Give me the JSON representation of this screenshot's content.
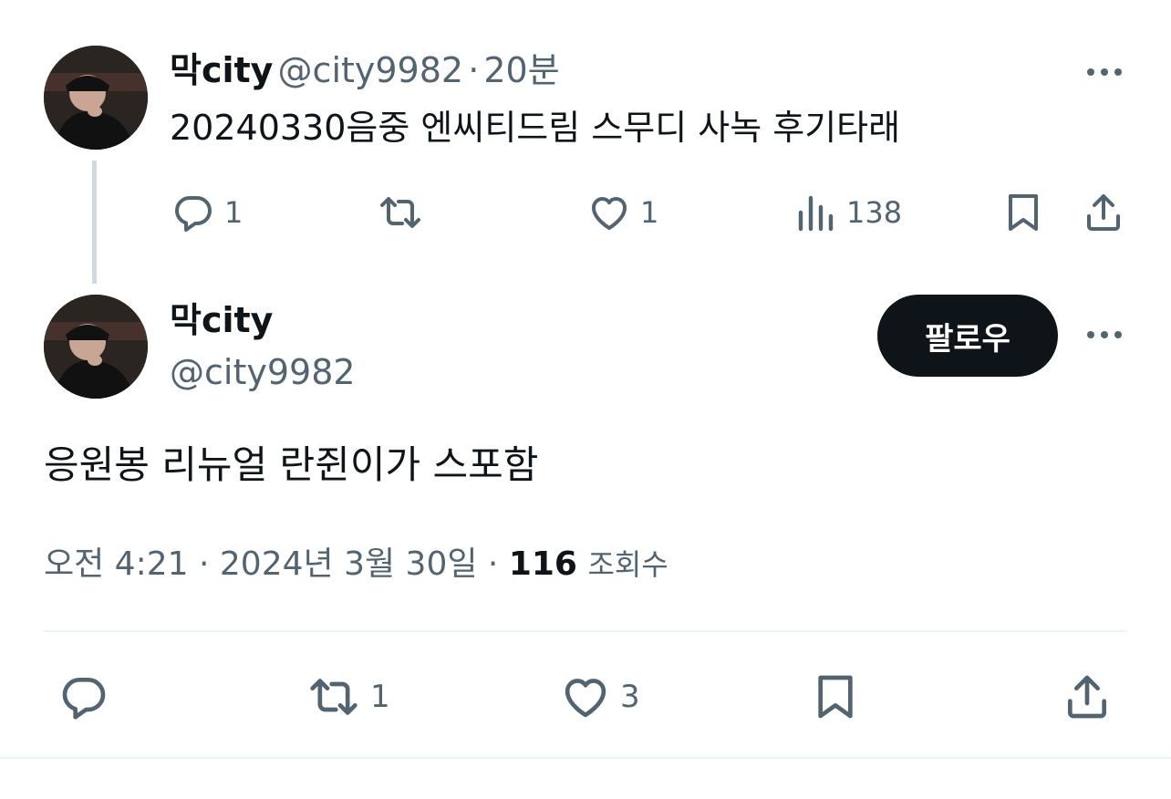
{
  "parent_tweet": {
    "display_name": "막city",
    "handle": "@city9982",
    "separator": "·",
    "time_ago": "20분",
    "text": "20240330음중 엔씨티드림 스무디 사녹 후기타래",
    "replies": "1",
    "reposts": "",
    "likes": "1",
    "views": "138"
  },
  "main_tweet": {
    "display_name": "막city",
    "handle": "@city9982",
    "follow_label": "팔로우",
    "text": "응원봉 리뉴얼 란쥔이가 스포함",
    "time": "오전 4:21",
    "separator": "·",
    "date": "2024년 3월 30일",
    "separator2": "·",
    "views_count": "116",
    "views_label": "조회수",
    "reposts": "1",
    "likes": "3"
  },
  "icons": {
    "reply": "reply-icon",
    "repost": "repost-icon",
    "like": "heart-icon",
    "views": "bar-chart-icon",
    "bookmark": "bookmark-icon",
    "share": "share-icon",
    "more": "more-dots-icon"
  },
  "colors": {
    "text": "#0f1419",
    "secondary": "#536471",
    "thread_line": "#cfd9de",
    "follow_bg": "#0f1419"
  }
}
